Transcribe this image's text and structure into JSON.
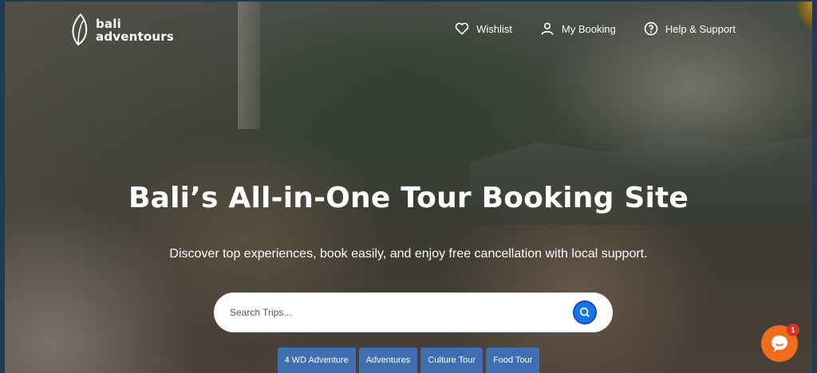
{
  "brand": {
    "line1": "bali",
    "line2": "adventours"
  },
  "nav": {
    "wishlist": "Wishlist",
    "booking": "My Booking",
    "support": "Help & Support"
  },
  "hero": {
    "title": "Bali’s All-in-One Tour Booking Site",
    "subtitle": "Discover top experiences, book easily, and enjoy free cancellation with local support."
  },
  "search": {
    "placeholder": "Search Trips..."
  },
  "chips": [
    "4 WD Adventure",
    "Adventures",
    "Culture Tour",
    "Food Tour"
  ],
  "chat": {
    "badge": "1"
  },
  "colors": {
    "accent": "#1a73e8",
    "chip": "#3f6fb0",
    "chat": "#f06d1d"
  },
  "icons": {
    "wishlist": "heart-icon",
    "booking": "user-icon",
    "support": "question-circle-icon",
    "search": "search-icon",
    "chat": "chat-bubble-icon"
  }
}
